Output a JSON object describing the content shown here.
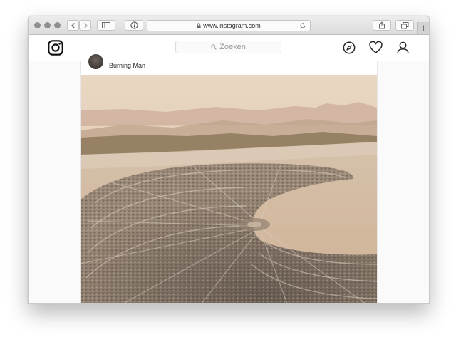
{
  "browser": {
    "address": "www.instagram.com",
    "icons": [
      "back-icon",
      "forward-icon",
      "sidebar-icon",
      "info-icon",
      "lock-icon",
      "reload-icon",
      "share-icon",
      "tabs-icon",
      "plus-icon"
    ]
  },
  "header": {
    "logo_icon": "instagram-logo-icon",
    "search_placeholder": "Zoeken",
    "icons": [
      "explore-compass-icon",
      "heart-icon",
      "profile-icon"
    ]
  },
  "post": {
    "username": "Burning Man",
    "photo_subject": "aerial-photo"
  }
}
